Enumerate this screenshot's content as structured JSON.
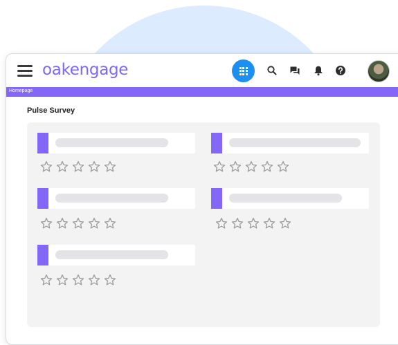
{
  "app": {
    "logo_text": "oakengage",
    "breadcrumb": "Homepage",
    "accent_color": "#8567f7",
    "apps_button_color": "#1f8fef"
  },
  "topbar_icons": [
    "apps-icon",
    "search-icon",
    "chat-icon",
    "bell-icon",
    "help-icon"
  ],
  "survey": {
    "title": "Pulse Survey",
    "questions": [
      {
        "rating": 0,
        "max": 5
      },
      {
        "rating": 0,
        "max": 5
      },
      {
        "rating": 0,
        "max": 5
      },
      {
        "rating": 0,
        "max": 5
      },
      {
        "rating": 0,
        "max": 5
      }
    ]
  }
}
